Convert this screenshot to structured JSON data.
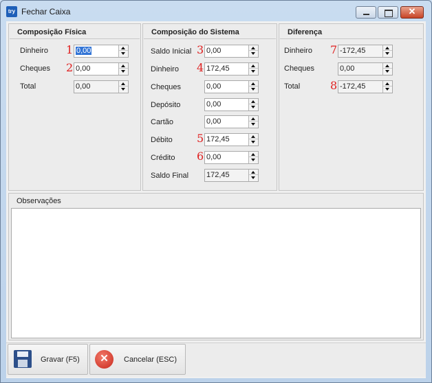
{
  "window": {
    "title": "Fechar Caixa",
    "icon_text": "try",
    "icon_name": "app-icon",
    "controls": [
      "minimize-icon",
      "maximize-icon",
      "close-icon"
    ],
    "close_glyph": "✕"
  },
  "fisica": {
    "title": "Composição Física",
    "rows": [
      {
        "label": "Dinheiro",
        "marker": "1",
        "value": "0,00"
      },
      {
        "label": "Cheques",
        "marker": "2",
        "value": "0,00"
      },
      {
        "label": "Total",
        "marker": "",
        "value": "0,00"
      }
    ]
  },
  "sistema": {
    "title": "Composição do Sistema",
    "rows": [
      {
        "label": "Saldo Inicial",
        "marker": "3",
        "value": "0,00"
      },
      {
        "label": "Dinheiro",
        "marker": "4",
        "value": "172,45"
      },
      {
        "label": "Cheques",
        "marker": "",
        "value": "0,00"
      },
      {
        "label": "Depósito",
        "marker": "",
        "value": "0,00"
      },
      {
        "label": "Cartão",
        "marker": "",
        "value": "0,00"
      },
      {
        "label": "Débito",
        "marker": "5",
        "value": "172,45"
      },
      {
        "label": "Crédito",
        "marker": "6",
        "value": "0,00"
      },
      {
        "label": "Saldo Final",
        "marker": "",
        "value": "172,45"
      }
    ]
  },
  "diferenca": {
    "title": "Diferença",
    "rows": [
      {
        "label": "Dinheiro",
        "marker": "7",
        "value": "-172,45"
      },
      {
        "label": "Cheques",
        "marker": "",
        "value": "0,00"
      },
      {
        "label": "Total",
        "marker": "8",
        "value": "-172,45"
      }
    ]
  },
  "observacoes": {
    "label": "Observações",
    "value": ""
  },
  "actions": {
    "save_label": "Gravar (F5)",
    "cancel_label": "Cancelar (ESC)",
    "cancel_glyph": "✕"
  },
  "colors": {
    "marker": "#e02020",
    "selection": "#3375d6",
    "window_frame": "#bcd2ea"
  }
}
